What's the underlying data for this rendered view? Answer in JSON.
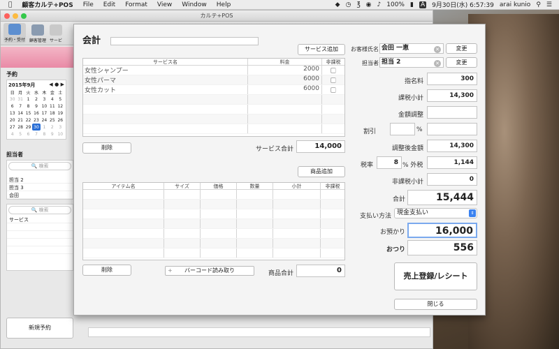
{
  "menubar": {
    "apple": "",
    "app_name": "顧客カルテ+POS",
    "items": [
      "File",
      "Edit",
      "Format",
      "View",
      "Window",
      "Help"
    ],
    "battery": "100%",
    "input_source": "A",
    "clock": "9月30日(水) 6:57:39",
    "user": "arai kunio"
  },
  "back_window": {
    "title": "カルテ+POS",
    "toolbar": [
      "予約・受付",
      "顧客管理",
      "サービ"
    ],
    "section_reserve": "予約",
    "calendar": {
      "month_label": "2015年9月",
      "weekdays": [
        "日",
        "月",
        "火",
        "水",
        "木",
        "金",
        "土"
      ],
      "weeks": [
        [
          "30",
          "31",
          "1",
          "2",
          "3",
          "4",
          "5"
        ],
        [
          "6",
          "7",
          "8",
          "9",
          "10",
          "11",
          "12"
        ],
        [
          "13",
          "14",
          "15",
          "16",
          "17",
          "18",
          "19"
        ],
        [
          "20",
          "21",
          "22",
          "23",
          "24",
          "25",
          "26"
        ],
        [
          "27",
          "28",
          "29",
          "30",
          "1",
          "2",
          "3"
        ],
        [
          "4",
          "5",
          "6",
          "7",
          "8",
          "9",
          "10"
        ]
      ],
      "today": "30"
    },
    "staff_label": "担当者",
    "search_placeholder": "検索",
    "staff_list": [
      "担当 2",
      "担当 3",
      "会田"
    ],
    "service_header": "サービス",
    "new_reservation": "新規予約"
  },
  "sheet": {
    "title": "会計",
    "add_service_button": "サービス追加",
    "service_table": {
      "headers": [
        "サービス名",
        "料金",
        "非課税"
      ],
      "rows": [
        {
          "name": "女性シャンプー",
          "price": "2000"
        },
        {
          "name": "女性パーマ",
          "price": "6000"
        },
        {
          "name": "女性カット",
          "price": "6000"
        }
      ]
    },
    "delete_button": "削除",
    "service_total_label": "サービス合計",
    "service_total": "14,000",
    "add_item_button": "商品追加",
    "item_table": {
      "headers": [
        "アイテム名",
        "サイズ",
        "価格",
        "数量",
        "小計",
        "非課税"
      ]
    },
    "delete_button_2": "削除",
    "barcode_button": "バーコード読み取り",
    "barcode_plus": "+",
    "item_total_label": "商品合計",
    "item_total": "0",
    "customer_label": "お客様氏名",
    "customer_name": "会田 一恵",
    "staff_label": "担当者",
    "staff_name": "担当 2",
    "change_label": "変更",
    "rows": {
      "shimei_label": "指名料",
      "shimei": "300",
      "kazei_label": "課税小計",
      "kazei": "14,300",
      "adjust_label": "金額調整",
      "adjust": "",
      "discount_label": "割引",
      "discount_pct": "",
      "discount_unit": "%",
      "discount_amount": "",
      "adjusted_label": "調整後金額",
      "adjusted": "14,300",
      "tax_label": "税率",
      "tax_rate": "8",
      "tax_unit": "% 外税",
      "tax": "1,144",
      "nontax_label": "非課税小計",
      "nontax": "0",
      "total_label": "合計",
      "total": "15,444",
      "payment_label": "支払い方法",
      "payment": "現金支払い",
      "deposit_label": "お預かり",
      "deposit": "16,000",
      "change_label": "おつり",
      "change": "556"
    },
    "register_button": "売上登録/レシート",
    "close_button": "閉じる"
  }
}
